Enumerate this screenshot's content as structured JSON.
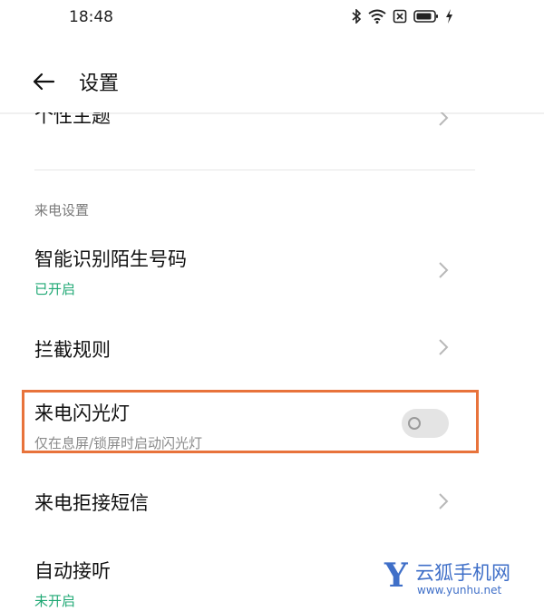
{
  "status_bar": {
    "time": "18:48",
    "icons": [
      "bluetooth-icon",
      "wifi-icon",
      "sim-icon",
      "battery-icon",
      "charging-icon"
    ]
  },
  "header": {
    "back_icon": "arrow-left-icon",
    "title": "设置"
  },
  "partial_item": {
    "title": "个性主题"
  },
  "section": {
    "header": "来电设置"
  },
  "items": [
    {
      "title": "智能识别陌生号码",
      "subtitle": "已开启"
    },
    {
      "title": "拦截规则"
    },
    {
      "title": "来电闪光灯",
      "subtitle": "仅在息屏/锁屏时启动闪光灯",
      "toggle_on": false
    },
    {
      "title": "来电拒接短信"
    },
    {
      "title": "自动接听",
      "subtitle": "未开启"
    }
  ],
  "colors": {
    "accent_green": "#1fa874",
    "highlight": "#e8733b",
    "watermark": "#3f6fc8"
  },
  "watermark": {
    "letter": "Y",
    "name": "云狐手机网",
    "url": "www.yunhu.net"
  }
}
